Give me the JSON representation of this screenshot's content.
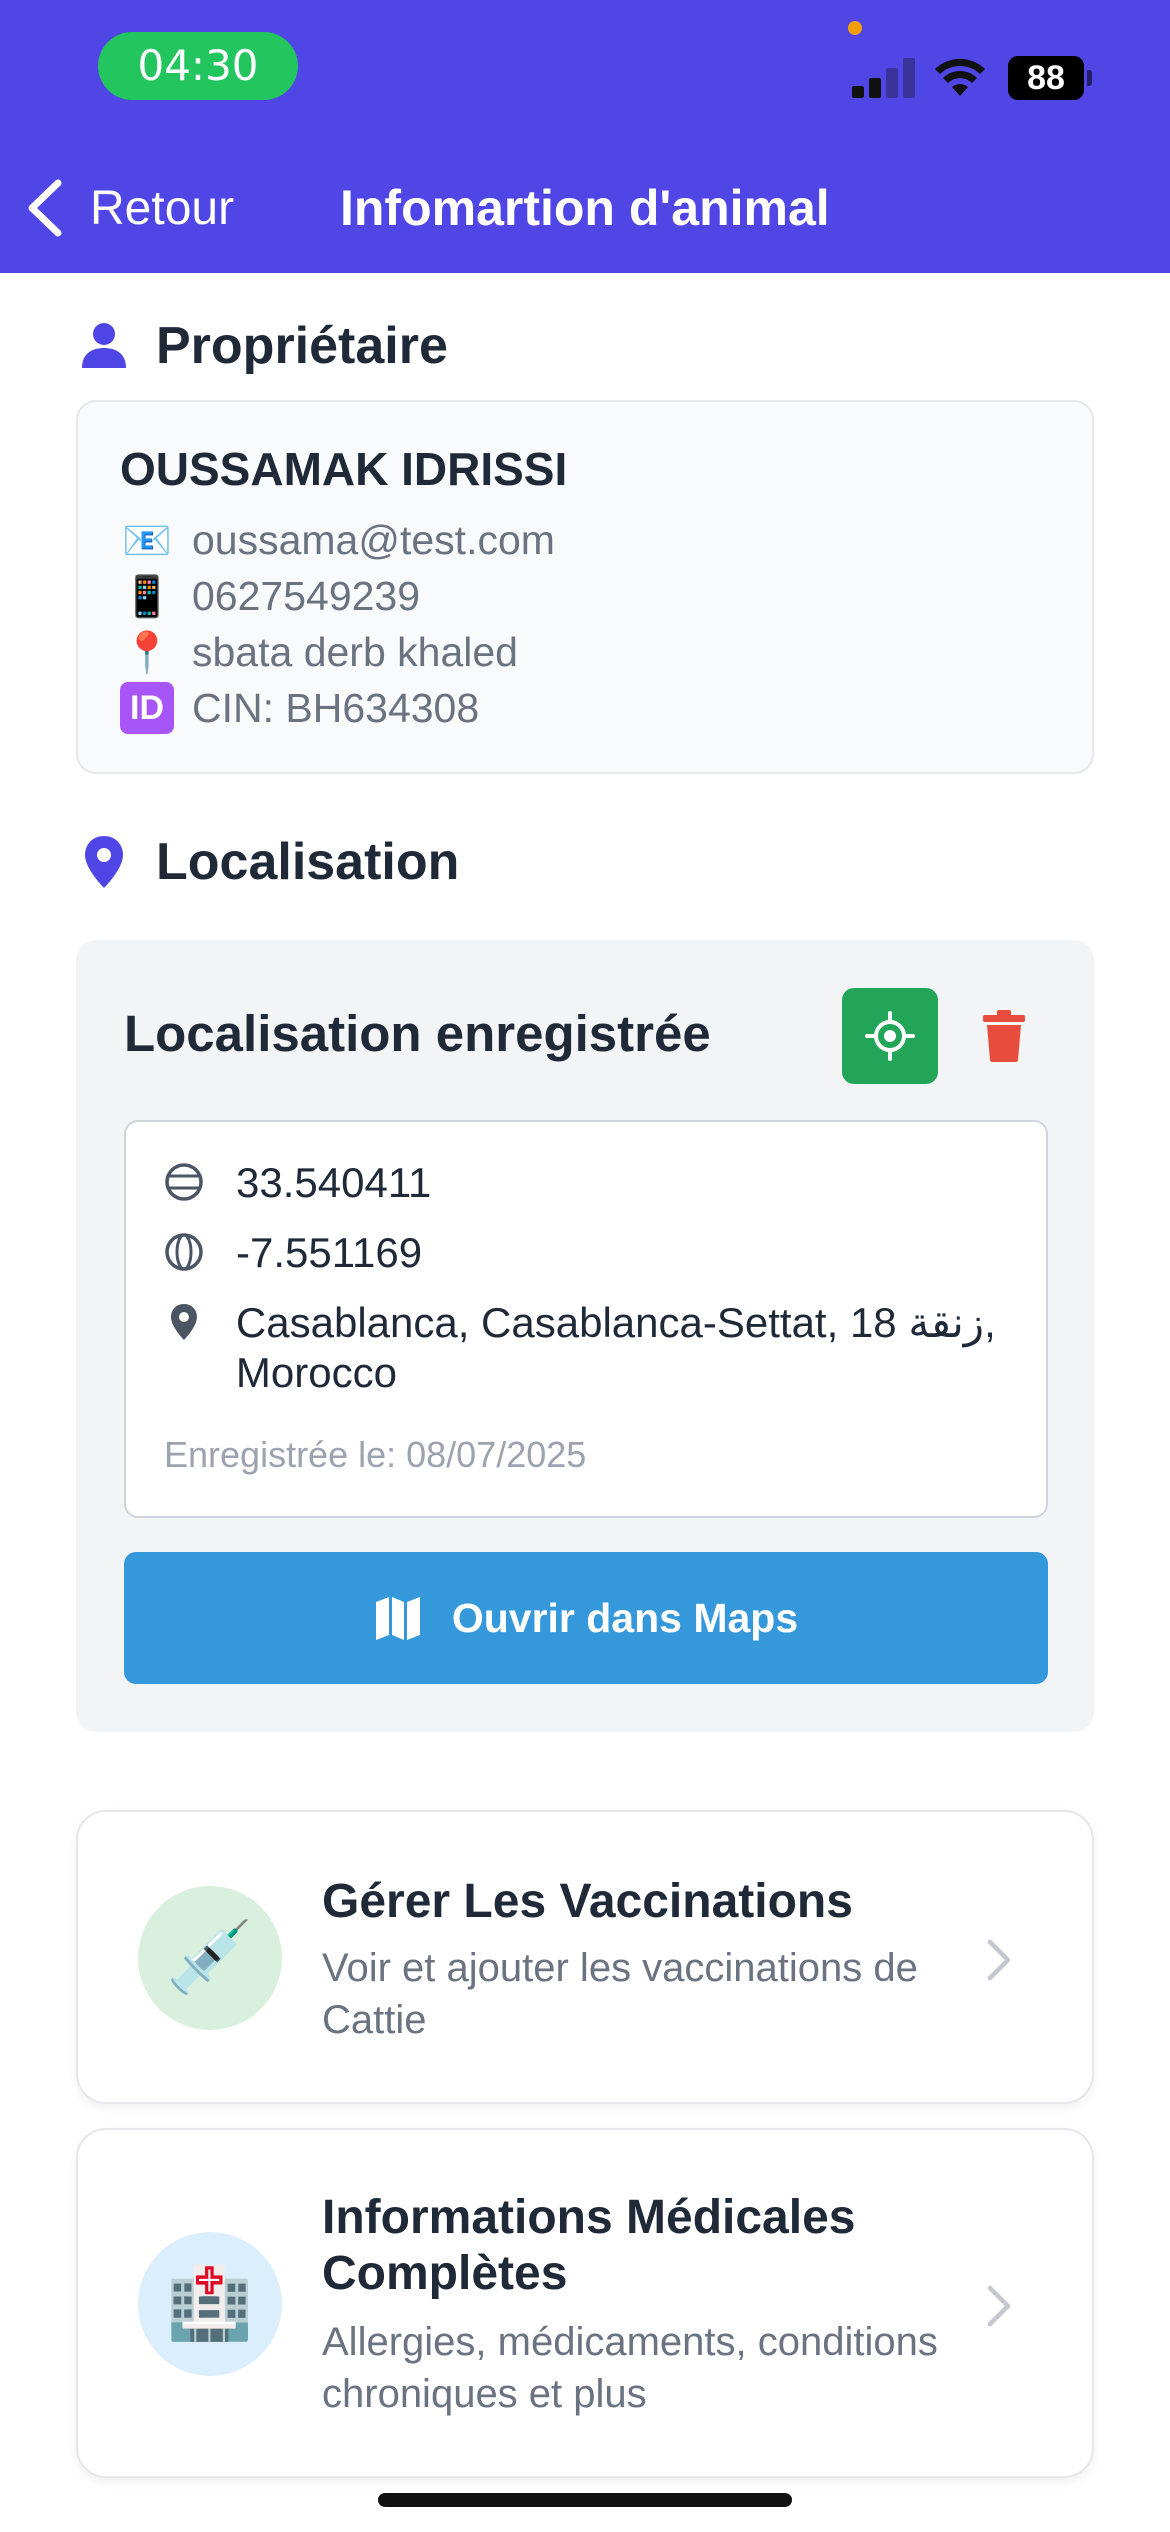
{
  "status_bar": {
    "time": "04:30",
    "battery": "88"
  },
  "nav": {
    "back_label": "Retour",
    "title": "Infomartion d'animal"
  },
  "owner_section": {
    "title": "Propriétaire",
    "name": "OUSSAMAK IDRISSI",
    "email_icon": "📧",
    "email": "oussama@test.com",
    "phone_icon": "📱",
    "phone": "0627549239",
    "address_icon": "📍",
    "address": "sbata derb khaled",
    "id_icon": "ID",
    "cin": "CIN: BH634308"
  },
  "location_section": {
    "title": "Localisation",
    "panel_title": "Localisation enregistrée",
    "latitude": "33.540411",
    "longitude": "-7.551169",
    "address": "Casablanca, Casablanca-Settat, زنقة 18, Morocco",
    "saved_at": "Enregistrée le: 08/07/2025",
    "maps_button": "Ouvrir dans Maps"
  },
  "features": [
    {
      "icon": "💉",
      "title": "Gérer Les Vaccinations",
      "description": "Voir et ajouter les vaccinations de Cattie"
    },
    {
      "icon": "🏥",
      "title": "Informations Médicales Complètes",
      "description": "Allergies, médicaments, conditions chroniques et plus"
    }
  ],
  "colors": {
    "header": "#4f46e5",
    "time_pill": "#22c55e",
    "locate_button": "#22a559",
    "delete_icon": "#e74c3c",
    "maps_button": "#3498db"
  }
}
